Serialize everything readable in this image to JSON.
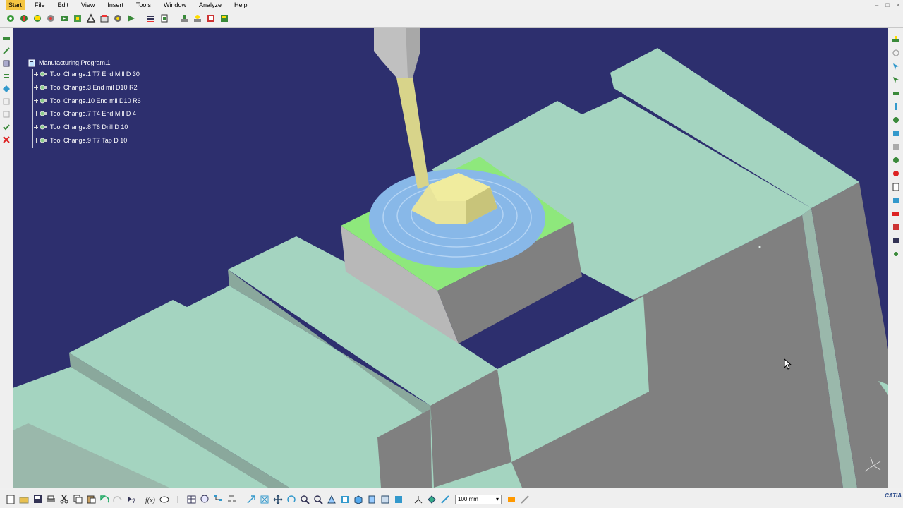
{
  "menu": {
    "items": [
      "Start",
      "File",
      "Edit",
      "View",
      "Insert",
      "Tools",
      "Window",
      "Analyze",
      "Help"
    ]
  },
  "tree": {
    "root": "Manufacturing Program.1",
    "items": [
      "Tool Change.1  T7 End Mill D 30",
      "Tool Change.3  End mil D10 R2",
      "Tool Change.10  End mil D10 R6",
      "Tool Change.7  T4 End Mill D 4",
      "Tool Change.8  T6 Drill D 10",
      "Tool Change.9  T7 Tap D 10"
    ]
  },
  "bottom": {
    "zoom_value": "100 mm"
  },
  "logo": {
    "text": "CATIA"
  },
  "colors": {
    "viewport_bg": "#2d2f6e",
    "stock_top": "#a4d4c0",
    "stock_side": "#808080",
    "part_green": "#8ee87c",
    "part_blue": "#88b8e8",
    "tool_yellow": "#e8e49a",
    "tool_gray": "#c0c0c0"
  },
  "icons": {
    "top_toolbar": [
      "update-icon",
      "refresh-icon",
      "settings-icon",
      "gear-icon",
      "replay-icon",
      "simulate-icon",
      "tool-path-icon",
      "stock-icon",
      "compute-icon",
      "video-icon",
      "list-icon",
      "report-icon",
      "machine-icon",
      "operation-icon",
      "program-icon",
      "output-icon"
    ],
    "bottom_toolbar": [
      "new-icon",
      "open-icon",
      "save-icon",
      "print-icon",
      "cut-icon",
      "copy-icon",
      "paste-icon",
      "undo-icon",
      "redo-icon",
      "whats-this-icon",
      "formula-icon",
      "comment-icon",
      "table-icon",
      "knowledge-icon",
      "tree-icon",
      "pan-icon",
      "fit-all-icon",
      "rotate-icon",
      "zoom-in-icon",
      "zoom-out-icon",
      "normal-view-icon",
      "view-icon",
      "render-icon",
      "hide-show-icon",
      "swap-icon",
      "measure-icon",
      "select-icon",
      "zoom-unit-icon",
      "ruler-icon",
      "annotation-icon"
    ]
  }
}
